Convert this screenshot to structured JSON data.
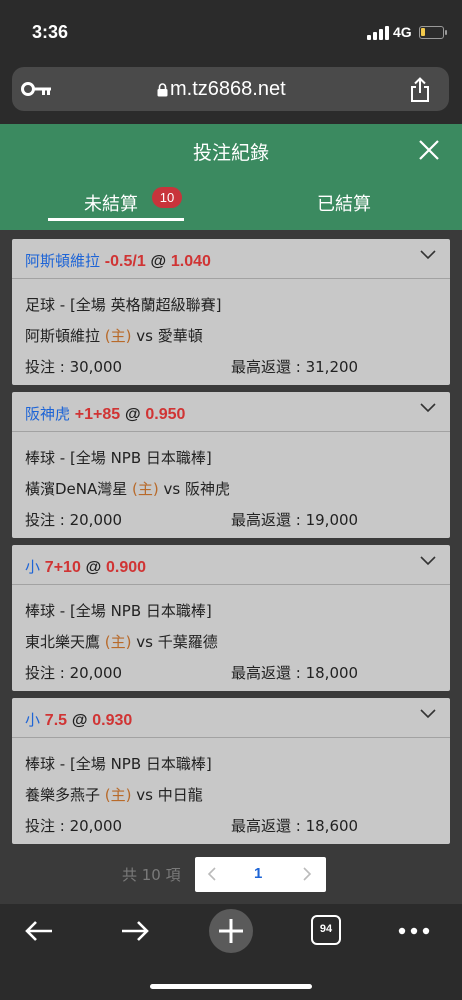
{
  "status_bar": {
    "time": "3:36",
    "network": "4G",
    "battery_color": "#f2c94c"
  },
  "browser": {
    "url": "m.tz6868.net",
    "icons": [
      "key-icon",
      "lock-icon",
      "share-icon"
    ]
  },
  "header": {
    "title": "投注紀錄",
    "close_icon": "close-icon",
    "color": "#3b8a60"
  },
  "tabs": [
    {
      "label": "未結算",
      "badge": "10",
      "active": true
    },
    {
      "label": "已結算",
      "active": false
    }
  ],
  "bets": [
    {
      "selection": "阿斯頓維拉",
      "handicap": "-0.5/1",
      "at": "@",
      "odds": "1.040",
      "league": "足球 - [全場 英格蘭超級聯賽]",
      "home": "阿斯頓維拉",
      "home_tag": "(主)",
      "vs": "vs",
      "away": "愛華頓",
      "stake_label": "投注 : 30,000",
      "return_label": "最高返還 : 31,200"
    },
    {
      "selection": "阪神虎",
      "handicap": "+1+85",
      "at": "@",
      "odds": "0.950",
      "league": "棒球 - [全場 NPB 日本職棒]",
      "home": "橫濱DeNA灣星",
      "home_tag": "(主)",
      "vs": "vs",
      "away": "阪神虎",
      "stake_label": "投注 : 20,000",
      "return_label": "最高返還 : 19,000"
    },
    {
      "selection": "小",
      "handicap": "7+10",
      "at": "@",
      "odds": "0.900",
      "league": "棒球 - [全場 NPB 日本職棒]",
      "home": "東北樂天鷹",
      "home_tag": "(主)",
      "vs": "vs",
      "away": "千葉羅德",
      "stake_label": "投注 : 20,000",
      "return_label": "最高返還 : 18,000"
    },
    {
      "selection": "小",
      "handicap": "7.5",
      "at": "@",
      "odds": "0.930",
      "league": "棒球 - [全場 NPB 日本職棒]",
      "home": "養樂多燕子",
      "home_tag": "(主)",
      "vs": "vs",
      "away": "中日龍",
      "stake_label": "投注 : 20,000",
      "return_label": "最高返還 : 18,600"
    }
  ],
  "pagination": {
    "total": "共 10 項",
    "current": "1",
    "prev": "‹",
    "next": "›"
  },
  "toolbar": {
    "tabs_count": "94",
    "icons": [
      "back-arrow-icon",
      "forward-arrow-icon",
      "new-tab-icon",
      "tabs-icon",
      "more-icon"
    ]
  },
  "colors": {
    "selection_blue": "#1d64d6",
    "odds_red": "#d03434",
    "home_tag": "#b86a2a",
    "badge": "#c8343b"
  }
}
